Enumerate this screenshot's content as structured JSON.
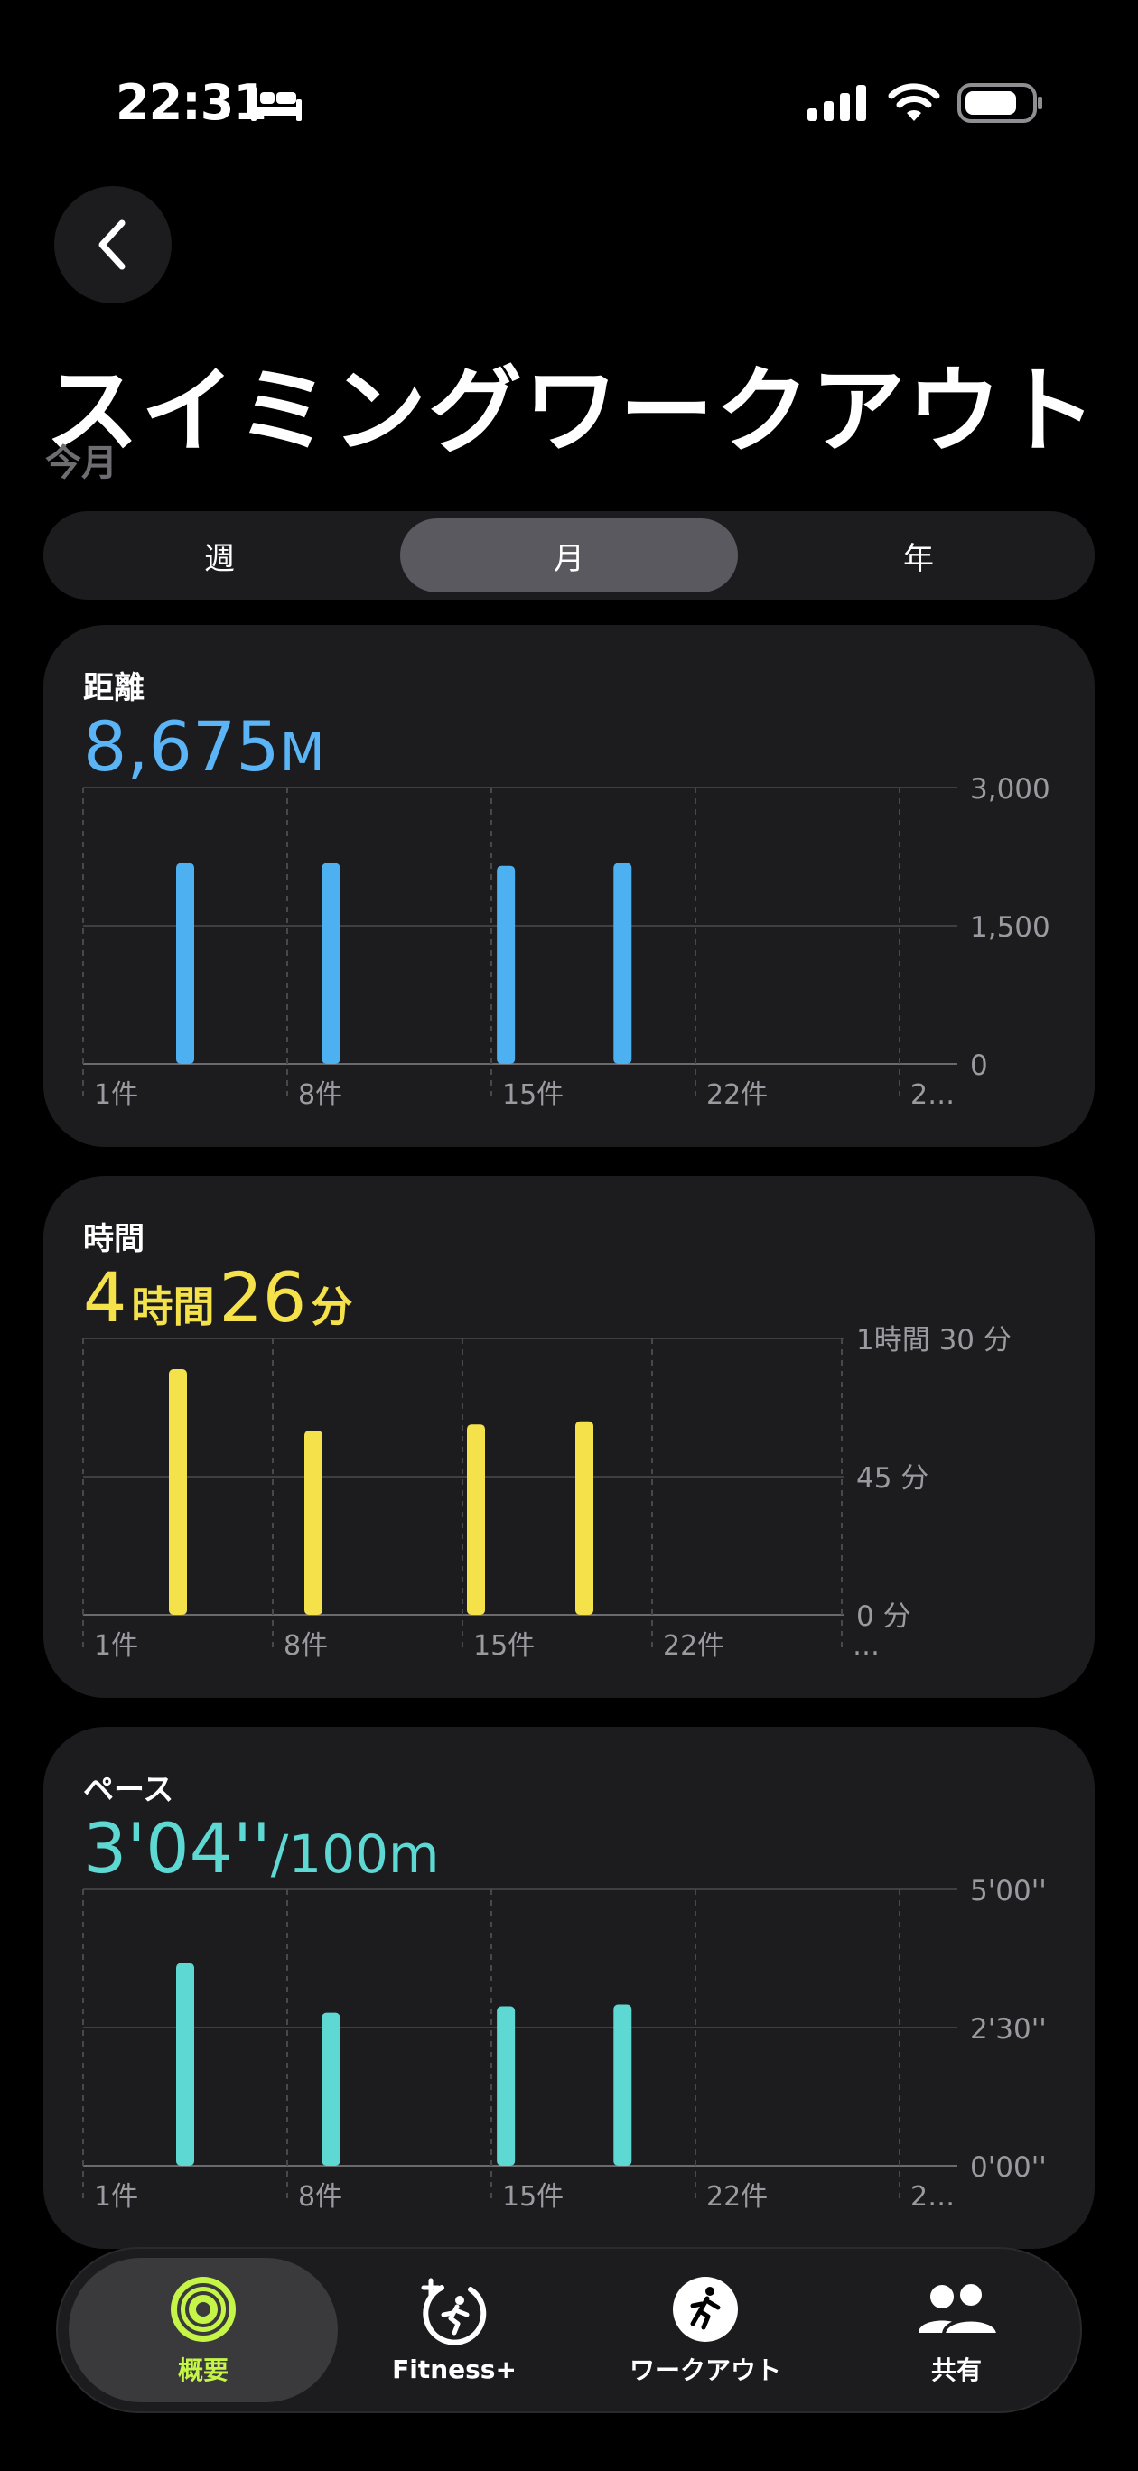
{
  "status_bar": {
    "time": "22:31",
    "icons": [
      "bed-icon",
      "cellular-signal-icon",
      "wifi-icon",
      "battery-icon"
    ]
  },
  "header": {
    "back_icon": "chevron-left-icon",
    "title": "スイミングワークアウト",
    "subtitle": "今月"
  },
  "segmented": {
    "items": [
      "週",
      "月",
      "年"
    ],
    "selected": "月"
  },
  "cards": {
    "distance": {
      "label": "距離",
      "value_number": "8,675",
      "value_unit": "M",
      "color": "#5ab4f5"
    },
    "duration": {
      "label": "時間",
      "hours": "4",
      "hours_unit": "時間",
      "minutes": "26",
      "minutes_unit": "分",
      "color": "#f5e24a"
    },
    "pace": {
      "label": "ペース",
      "value_number": "3'04''",
      "value_unit": "/100m",
      "color": "#5ed8d2"
    }
  },
  "chart_data": [
    {
      "type": "bar",
      "title": "距離",
      "x_ticks": [
        "1件",
        "8件",
        "15件",
        "22件",
        "2…"
      ],
      "y_ticks": [
        "3,000",
        "1,500",
        "0"
      ],
      "ylim": [
        0,
        3000
      ],
      "bars": [
        {
          "day": 4,
          "value": 2180
        },
        {
          "day": 9,
          "value": 2180
        },
        {
          "day": 15,
          "value": 2150
        },
        {
          "day": 19,
          "value": 2180
        }
      ],
      "color": "#4db0f0"
    },
    {
      "type": "bar",
      "title": "時間",
      "x_ticks": [
        "1件",
        "8件",
        "15件",
        "22件",
        "…"
      ],
      "y_ticks": [
        "1時間 30 分",
        "45 分",
        "0 分"
      ],
      "ylim": [
        0,
        90
      ],
      "bars": [
        {
          "day": 4,
          "value": 80
        },
        {
          "day": 9,
          "value": 60
        },
        {
          "day": 15,
          "value": 62
        },
        {
          "day": 19,
          "value": 63
        }
      ],
      "color": "#f5e14a"
    },
    {
      "type": "bar",
      "title": "ペース",
      "x_ticks": [
        "1件",
        "8件",
        "15件",
        "22件",
        "2…"
      ],
      "y_ticks": [
        "5'00''",
        "2'30''",
        "0'00''"
      ],
      "ylim": [
        0,
        300
      ],
      "bars": [
        {
          "day": 4,
          "value": 220
        },
        {
          "day": 9,
          "value": 166
        },
        {
          "day": 15,
          "value": 173
        },
        {
          "day": 19,
          "value": 175
        }
      ],
      "color": "#5ed8d2"
    }
  ],
  "tabbar": {
    "items": [
      {
        "label": "概要",
        "icon": "activity-rings-icon",
        "active": true
      },
      {
        "label": "Fitness+",
        "icon": "fitness-plus-icon",
        "active": false
      },
      {
        "label": "ワークアウト",
        "icon": "workout-runner-icon",
        "active": false
      },
      {
        "label": "共有",
        "icon": "sharing-people-icon",
        "active": false
      }
    ],
    "active_color": "#c5f547"
  }
}
